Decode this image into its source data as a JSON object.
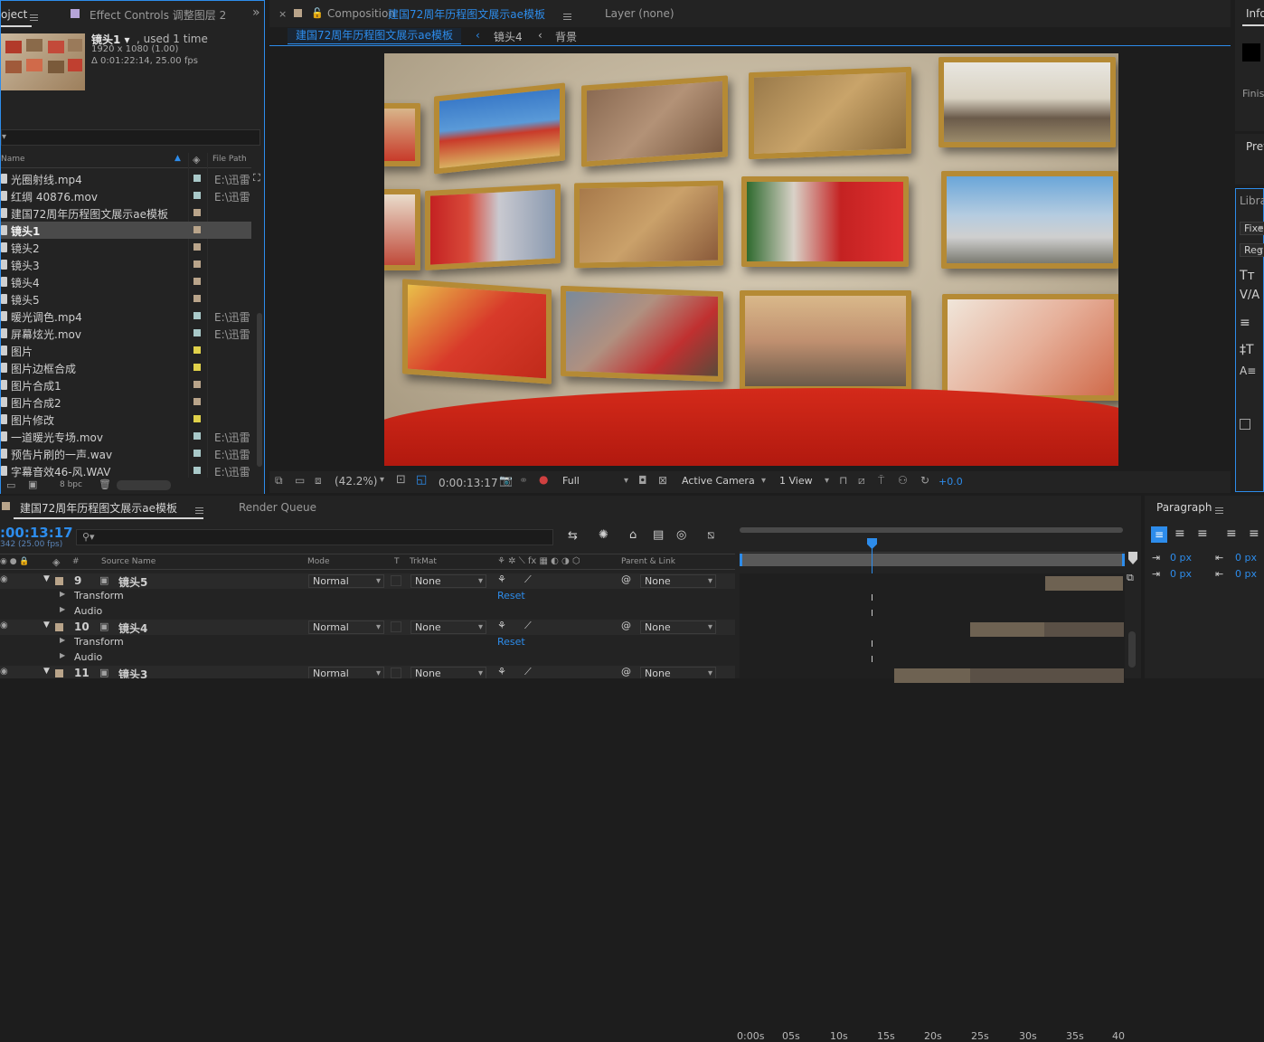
{
  "project_panel": {
    "tab_project": "oject",
    "tab_effect_controls": "Effect Controls 调整图层 2",
    "selected_name": "镜头1 ▾",
    "selected_used": ", used 1 time",
    "selected_res": "1920 x 1080 (1.00)",
    "selected_dur": "Δ 0:01:22:14, 25.00 fps",
    "col_name": "Name",
    "col_filepath": "File Path",
    "bpc": "8 bpc",
    "items": [
      {
        "name": "光圈射线.mp4",
        "color": "#a9c9c9",
        "path": "E:\\迅雷"
      },
      {
        "name": "红绸 40876.mov",
        "color": "#a9c9c9",
        "path": "E:\\迅雷"
      },
      {
        "name": "建国72周年历程图文展示ae模板",
        "color": "#b9a48a",
        "path": ""
      },
      {
        "name": "镜头1",
        "color": "#b9a48a",
        "path": ""
      },
      {
        "name": "镜头2",
        "color": "#b9a48a",
        "path": ""
      },
      {
        "name": "镜头3",
        "color": "#b9a48a",
        "path": ""
      },
      {
        "name": "镜头4",
        "color": "#b9a48a",
        "path": ""
      },
      {
        "name": "镜头5",
        "color": "#b9a48a",
        "path": ""
      },
      {
        "name": "暖光调色.mp4",
        "color": "#a9c9c9",
        "path": "E:\\迅雷"
      },
      {
        "name": "屏幕炫光.mov",
        "color": "#a9c9c9",
        "path": "E:\\迅雷"
      },
      {
        "name": "图片",
        "color": "#e0d14a",
        "path": ""
      },
      {
        "name": "图片边框合成",
        "color": "#e0d14a",
        "path": ""
      },
      {
        "name": "图片合成1",
        "color": "#b9a48a",
        "path": ""
      },
      {
        "name": "图片合成2",
        "color": "#b9a48a",
        "path": ""
      },
      {
        "name": "图片修改",
        "color": "#e0d14a",
        "path": ""
      },
      {
        "name": "一道暖光专场.mov",
        "color": "#a9c9c9",
        "path": "E:\\迅雷"
      },
      {
        "name": "预告片刷的一声.wav",
        "color": "#a9c9c9",
        "path": "E:\\迅雷"
      },
      {
        "name": "字幕音效46-风.WAV",
        "color": "#a9c9c9",
        "path": "E:\\迅雷"
      }
    ]
  },
  "composition_panel": {
    "tab_label": "Composition",
    "tab_comp_name": "建国72周年历程图文展示ae模板",
    "layer_tab": "Layer (none)",
    "breadcrumbs": [
      "建国72周年历程图文展示ae模板",
      "镜头4",
      "背景"
    ],
    "zoom": "(42.2%)",
    "timecode": "0:00:13:17",
    "resolution": "Full",
    "camera": "Active Camera",
    "view": "1 View",
    "exposure": "+0.0"
  },
  "right_panel": {
    "info": "Info",
    "finish": "Finis",
    "preview": "Prev",
    "libraries": "Librari",
    "fixed": "Fixe",
    "regular": "Reg",
    "paragraph": "Paragraph",
    "px1": "0 px",
    "px2": "0 px",
    "px3": "0 px",
    "px4": "0 px"
  },
  "timeline": {
    "tab_comp": "建国72周年历程图文展示ae模板",
    "tab_render": "Render Queue",
    "timecode": ":00:13:17",
    "frames": "342 (25.00 fps)",
    "search_placeholder": "",
    "col_hash": "#",
    "col_source": "Source Name",
    "col_mode": "Mode",
    "col_t": "T",
    "col_trkmat": "TrkMat",
    "col_parent": "Parent & Link",
    "ruler": [
      "0:00s",
      "05s",
      "10s",
      "15s",
      "20s",
      "25s",
      "30s",
      "35s",
      "40"
    ],
    "layers": [
      {
        "num": "9",
        "name": "镜头5",
        "mode": "Normal",
        "trkmat": "None",
        "parent": "None"
      },
      {
        "num": "10",
        "name": "镜头4",
        "mode": "Normal",
        "trkmat": "None",
        "parent": "None"
      },
      {
        "num": "11",
        "name": "镜头3",
        "mode": "Normal",
        "trkmat": "None",
        "parent": "None"
      }
    ],
    "transform": "Transform",
    "audio": "Audio",
    "reset": "Reset"
  },
  "colors": {
    "accent": "#2d8ceb",
    "panel_bg": "#232323",
    "frame_gold": "#b58a35"
  }
}
